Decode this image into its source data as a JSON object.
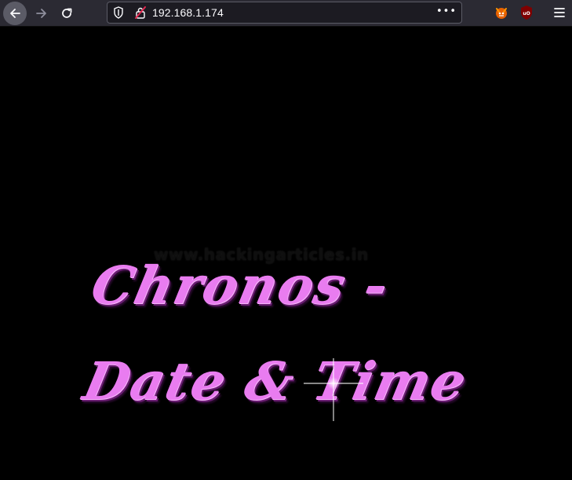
{
  "browser": {
    "url": "192.168.1.174",
    "overflow_menu_label": "•••",
    "icons": {
      "back": "back-arrow-icon",
      "forward": "forward-arrow-icon",
      "reload": "reload-icon",
      "tracking_protection": "shield-icon",
      "connection": "insecure-lock-icon",
      "extension_1": "fox-extension-icon",
      "extension_2": "ublock-origin-icon",
      "app_menu": "hamburger-menu-icon"
    },
    "colors": {
      "toolbar": "#2b2a33",
      "urlbar": "#1c1b22",
      "insecure_lock": "#e22850"
    }
  },
  "page": {
    "watermark": "www.hackingarticles.in",
    "title_line1": "Chronos -",
    "title_line2": "Date & Time",
    "colors": {
      "background": "#000000",
      "title_fill": "#e97cf0",
      "title_shadow": "#6a1d72"
    }
  }
}
